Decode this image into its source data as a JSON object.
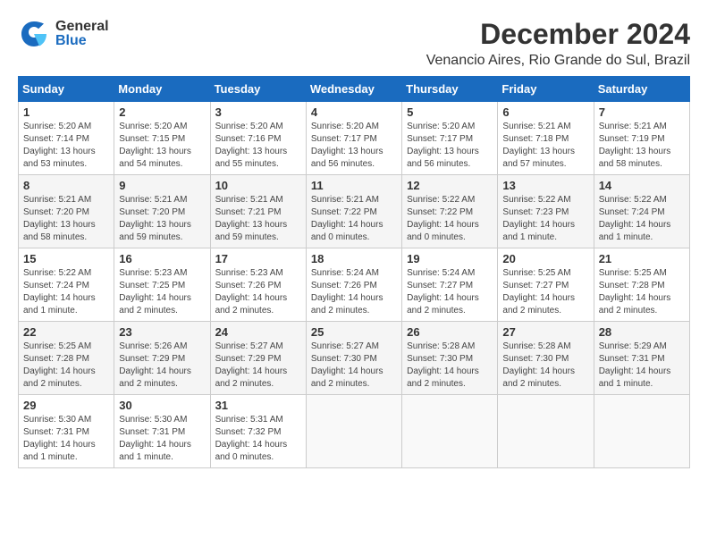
{
  "header": {
    "logo_general": "General",
    "logo_blue": "Blue",
    "title": "December 2024",
    "subtitle": "Venancio Aires, Rio Grande do Sul, Brazil"
  },
  "calendar": {
    "days_of_week": [
      "Sunday",
      "Monday",
      "Tuesday",
      "Wednesday",
      "Thursday",
      "Friday",
      "Saturday"
    ],
    "weeks": [
      [
        null,
        null,
        null,
        null,
        null,
        null,
        null
      ]
    ],
    "cells": [
      {
        "day": "1",
        "info": "Sunrise: 5:20 AM\nSunset: 7:14 PM\nDaylight: 13 hours\nand 53 minutes."
      },
      {
        "day": "2",
        "info": "Sunrise: 5:20 AM\nSunset: 7:15 PM\nDaylight: 13 hours\nand 54 minutes."
      },
      {
        "day": "3",
        "info": "Sunrise: 5:20 AM\nSunset: 7:16 PM\nDaylight: 13 hours\nand 55 minutes."
      },
      {
        "day": "4",
        "info": "Sunrise: 5:20 AM\nSunset: 7:17 PM\nDaylight: 13 hours\nand 56 minutes."
      },
      {
        "day": "5",
        "info": "Sunrise: 5:20 AM\nSunset: 7:17 PM\nDaylight: 13 hours\nand 56 minutes."
      },
      {
        "day": "6",
        "info": "Sunrise: 5:21 AM\nSunset: 7:18 PM\nDaylight: 13 hours\nand 57 minutes."
      },
      {
        "day": "7",
        "info": "Sunrise: 5:21 AM\nSunset: 7:19 PM\nDaylight: 13 hours\nand 58 minutes."
      },
      {
        "day": "8",
        "info": "Sunrise: 5:21 AM\nSunset: 7:20 PM\nDaylight: 13 hours\nand 58 minutes."
      },
      {
        "day": "9",
        "info": "Sunrise: 5:21 AM\nSunset: 7:20 PM\nDaylight: 13 hours\nand 59 minutes."
      },
      {
        "day": "10",
        "info": "Sunrise: 5:21 AM\nSunset: 7:21 PM\nDaylight: 13 hours\nand 59 minutes."
      },
      {
        "day": "11",
        "info": "Sunrise: 5:21 AM\nSunset: 7:22 PM\nDaylight: 14 hours\nand 0 minutes."
      },
      {
        "day": "12",
        "info": "Sunrise: 5:22 AM\nSunset: 7:22 PM\nDaylight: 14 hours\nand 0 minutes."
      },
      {
        "day": "13",
        "info": "Sunrise: 5:22 AM\nSunset: 7:23 PM\nDaylight: 14 hours\nand 1 minute."
      },
      {
        "day": "14",
        "info": "Sunrise: 5:22 AM\nSunset: 7:24 PM\nDaylight: 14 hours\nand 1 minute."
      },
      {
        "day": "15",
        "info": "Sunrise: 5:22 AM\nSunset: 7:24 PM\nDaylight: 14 hours\nand 1 minute."
      },
      {
        "day": "16",
        "info": "Sunrise: 5:23 AM\nSunset: 7:25 PM\nDaylight: 14 hours\nand 2 minutes."
      },
      {
        "day": "17",
        "info": "Sunrise: 5:23 AM\nSunset: 7:26 PM\nDaylight: 14 hours\nand 2 minutes."
      },
      {
        "day": "18",
        "info": "Sunrise: 5:24 AM\nSunset: 7:26 PM\nDaylight: 14 hours\nand 2 minutes."
      },
      {
        "day": "19",
        "info": "Sunrise: 5:24 AM\nSunset: 7:27 PM\nDaylight: 14 hours\nand 2 minutes."
      },
      {
        "day": "20",
        "info": "Sunrise: 5:25 AM\nSunset: 7:27 PM\nDaylight: 14 hours\nand 2 minutes."
      },
      {
        "day": "21",
        "info": "Sunrise: 5:25 AM\nSunset: 7:28 PM\nDaylight: 14 hours\nand 2 minutes."
      },
      {
        "day": "22",
        "info": "Sunrise: 5:25 AM\nSunset: 7:28 PM\nDaylight: 14 hours\nand 2 minutes."
      },
      {
        "day": "23",
        "info": "Sunrise: 5:26 AM\nSunset: 7:29 PM\nDaylight: 14 hours\nand 2 minutes."
      },
      {
        "day": "24",
        "info": "Sunrise: 5:27 AM\nSunset: 7:29 PM\nDaylight: 14 hours\nand 2 minutes."
      },
      {
        "day": "25",
        "info": "Sunrise: 5:27 AM\nSunset: 7:30 PM\nDaylight: 14 hours\nand 2 minutes."
      },
      {
        "day": "26",
        "info": "Sunrise: 5:28 AM\nSunset: 7:30 PM\nDaylight: 14 hours\nand 2 minutes."
      },
      {
        "day": "27",
        "info": "Sunrise: 5:28 AM\nSunset: 7:30 PM\nDaylight: 14 hours\nand 2 minutes."
      },
      {
        "day": "28",
        "info": "Sunrise: 5:29 AM\nSunset: 7:31 PM\nDaylight: 14 hours\nand 1 minute."
      },
      {
        "day": "29",
        "info": "Sunrise: 5:30 AM\nSunset: 7:31 PM\nDaylight: 14 hours\nand 1 minute."
      },
      {
        "day": "30",
        "info": "Sunrise: 5:30 AM\nSunset: 7:31 PM\nDaylight: 14 hours\nand 1 minute."
      },
      {
        "day": "31",
        "info": "Sunrise: 5:31 AM\nSunset: 7:32 PM\nDaylight: 14 hours\nand 0 minutes."
      }
    ]
  }
}
